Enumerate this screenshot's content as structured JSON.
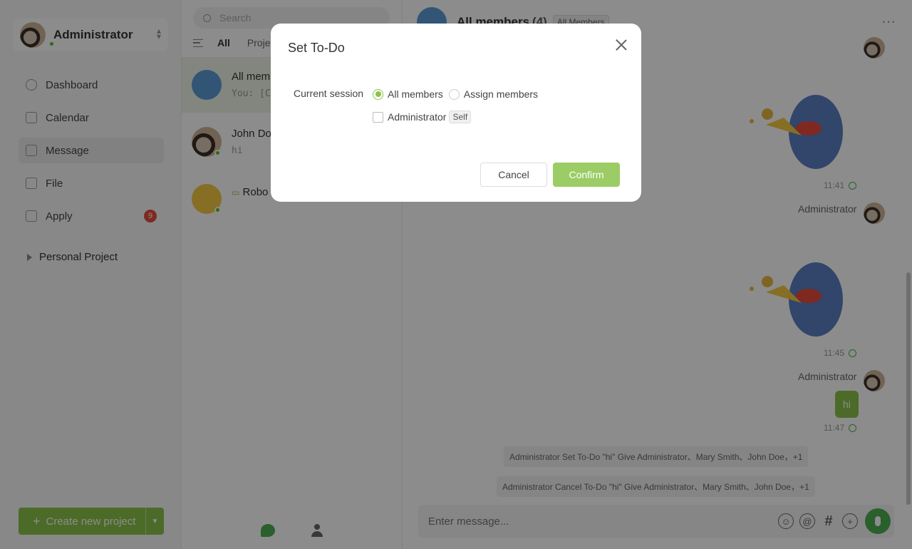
{
  "sidebar": {
    "user_name": "Administrator",
    "nav": [
      {
        "label": "Dashboard",
        "icon": "dashboard-icon"
      },
      {
        "label": "Calendar",
        "icon": "calendar-icon"
      },
      {
        "label": "Message",
        "icon": "message-icon"
      },
      {
        "label": "File",
        "icon": "file-icon"
      },
      {
        "label": "Apply",
        "icon": "apply-icon",
        "badge": "9"
      }
    ],
    "project_group": "Personal Project",
    "create_label": "Create new project"
  },
  "sessions": {
    "search_placeholder": "Search",
    "tabs": [
      "All",
      "Projec"
    ],
    "items": [
      {
        "title": "All memb",
        "subtitle": "You: [Can"
      },
      {
        "title": "John Doe",
        "subtitle": "hi"
      },
      {
        "title": "Robo",
        "subtitle": ""
      }
    ]
  },
  "chat": {
    "title": "All members",
    "count": "(4)",
    "tag": "All Members",
    "messages": {
      "time1": "11:41",
      "sender1": "Administrator",
      "time2": "11:45",
      "sender2": "Administrator",
      "bubble": "hi",
      "time3": "11:47"
    },
    "notices": [
      "Administrator Set To-Do \"hi\" Give Administrator、Mary Smith、John Doe，+1",
      "Administrator Cancel To-Do \"hi\" Give Administrator、Mary Smith、John Doe，+1"
    ],
    "composer_placeholder": "Enter message..."
  },
  "modal": {
    "title": "Set To-Do",
    "label": "Current session",
    "option_all": "All members",
    "option_assign": "Assign members",
    "selected": "All members",
    "member_name": "Administrator",
    "member_tag": "Self",
    "cancel": "Cancel",
    "confirm": "Confirm"
  },
  "colors": {
    "accent": "#8bc34a",
    "online": "#52c41a",
    "badge": "#e74c3c"
  }
}
